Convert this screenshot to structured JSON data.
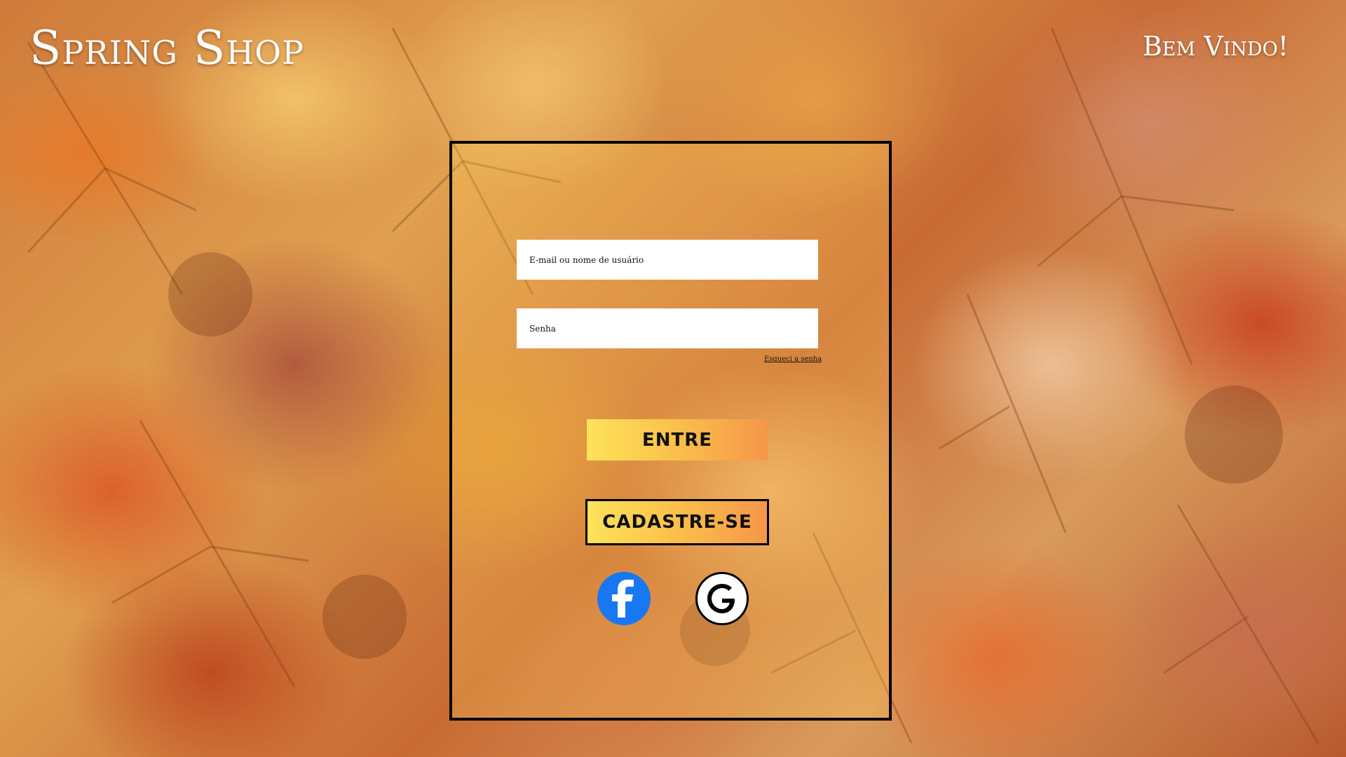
{
  "header": {
    "brand": "Spring Shop",
    "welcome": "Bem Vindo!"
  },
  "login": {
    "email_placeholder": "E-mail ou nome de usuário",
    "password_placeholder": "Senha",
    "forgot_password": "Esqueci a senha",
    "login_button": "ENTRE",
    "signup_button": "CADASTRE-SE",
    "social": [
      "facebook-icon",
      "google-icon"
    ]
  },
  "colors": {
    "text_light": "#ffffff",
    "panel_border": "#000000",
    "button_gradient_start": "#fde35a",
    "button_gradient_end": "#f5964a",
    "facebook_blue": "#1877f2"
  }
}
